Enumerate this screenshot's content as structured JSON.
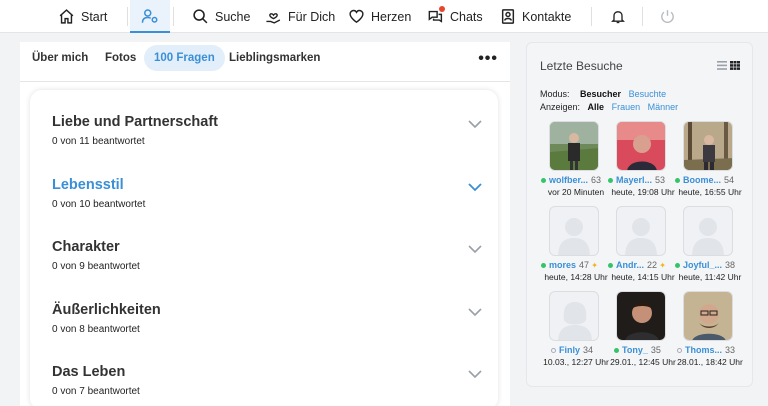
{
  "nav": {
    "items": [
      {
        "label": "Start",
        "icon": "home-icon"
      },
      {
        "label": "",
        "icon": "user-settings-icon"
      },
      {
        "label": "Suche",
        "icon": "search-icon"
      },
      {
        "label": "Für Dich",
        "icon": "hand-heart-icon"
      },
      {
        "label": "Herzen",
        "icon": "heart-icon"
      },
      {
        "label": "Chats",
        "icon": "chat-icon"
      },
      {
        "label": "Kontakte",
        "icon": "contacts-icon"
      }
    ],
    "bell_icon": "bell-icon",
    "power_icon": "power-icon",
    "accent": "#3a8fd6",
    "notification_color": "#e8452f"
  },
  "tabs": [
    {
      "label": "Über mich"
    },
    {
      "label": "Fotos"
    },
    {
      "label": "100 Fragen"
    },
    {
      "label": "Lieblingsmarken"
    }
  ],
  "more_label": "•••",
  "questions": [
    {
      "title": "Liebe und Partnerschaft",
      "answered": "0 von 11 beantwortet"
    },
    {
      "title": "Lebensstil",
      "answered": "0 von 10 beantwortet"
    },
    {
      "title": "Charakter",
      "answered": "0 von 9 beantwortet"
    },
    {
      "title": "Äußerlichkeiten",
      "answered": "0 von 8 beantwortet"
    },
    {
      "title": "Das Leben",
      "answered": "0 von 7 beantwortet"
    }
  ],
  "visits": {
    "title": "Letzte Besuche",
    "modus_label": "Modus:",
    "modus_options": [
      "Besucher",
      "Besuchte"
    ],
    "show_label": "Anzeigen:",
    "show_options": [
      "Alle",
      "Frauen",
      "Männer"
    ],
    "items": [
      {
        "name": "wolfber...",
        "age": "63",
        "time": "vor 20 Minuten",
        "online": true,
        "photo": "man-outdoor",
        "spark": false
      },
      {
        "name": "Mayerl...",
        "age": "53",
        "time": "heute, 19:08 Uhr",
        "online": true,
        "photo": "man-red",
        "spark": false
      },
      {
        "name": "Boome...",
        "age": "54",
        "time": "heute, 16:55 Uhr",
        "online": true,
        "photo": "man-park",
        "spark": false
      },
      {
        "name": "mores",
        "age": "47",
        "time": "heute, 14:28 Uhr",
        "online": true,
        "photo": "placeholder-male",
        "spark": true
      },
      {
        "name": "Andr...",
        "age": "22",
        "time": "heute, 14:15 Uhr",
        "online": true,
        "photo": "placeholder-male",
        "spark": true
      },
      {
        "name": "Joyful_...",
        "age": "38",
        "time": "heute, 11:42 Uhr",
        "online": true,
        "photo": "placeholder-male",
        "spark": false
      },
      {
        "name": "Finly",
        "age": "34",
        "time": "10.03., 12:27 Uhr",
        "online": false,
        "photo": "placeholder-female",
        "spark": false
      },
      {
        "name": "Tony_",
        "age": "35",
        "time": "29.01., 12:45 Uhr",
        "online": true,
        "photo": "man-dark",
        "spark": false
      },
      {
        "name": "Thoms...",
        "age": "33",
        "time": "28.01., 18:42 Uhr",
        "online": false,
        "photo": "man-glasses",
        "spark": false
      }
    ]
  }
}
